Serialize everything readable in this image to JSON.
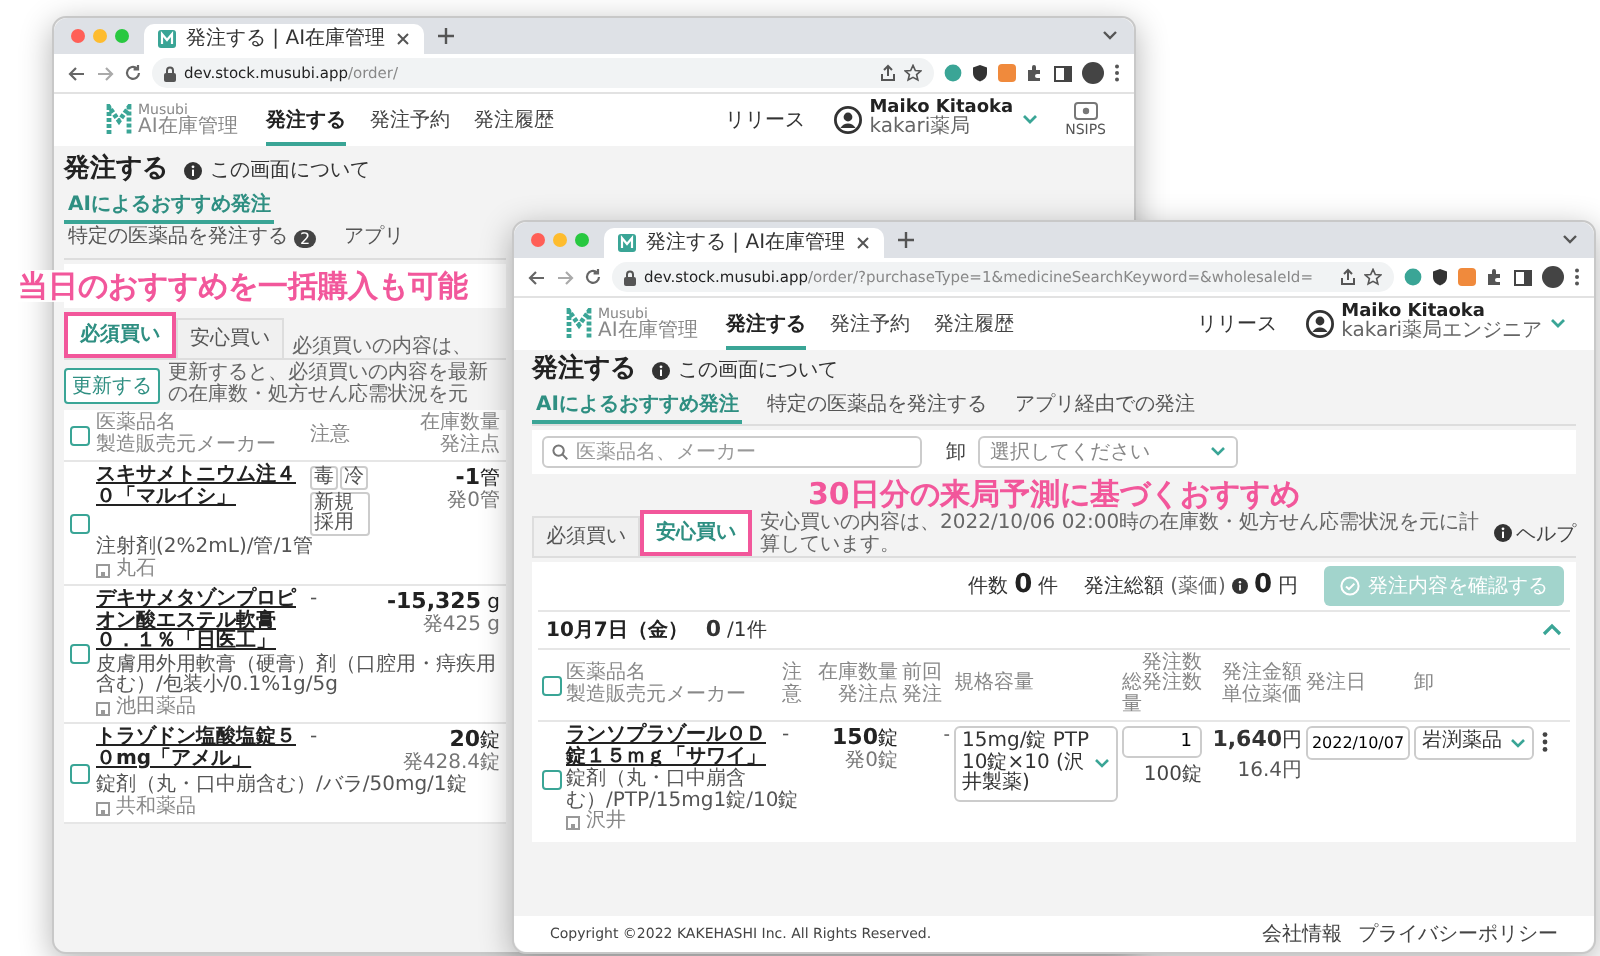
{
  "windows": [
    {
      "kind": "back",
      "browser_tab": "発注する | AI在庫管理",
      "url": "**dev.stock.musubi.app**/order/",
      "logo": {
        "name": "Musubi",
        "subtitle": "AI在庫管理"
      },
      "nav": [
        {
          "label": "発注する",
          "selected": true
        },
        {
          "label": "発注予約",
          "selected": false
        },
        {
          "label": "発注履歴",
          "selected": false
        }
      ],
      "release_link": "リリース",
      "user": {
        "name": "Maiko Kitaoka",
        "org": "kakari薬局"
      },
      "nsips": "NSIPS",
      "page_title": "発注する",
      "about_link": "この画面について",
      "tabs": [
        {
          "label": "AIによるおすすめ発注",
          "selected": true
        },
        {
          "label": "特定の医薬品を発注する",
          "selected": false,
          "badge": "2"
        },
        {
          "label": "アプリ",
          "selected": false
        }
      ],
      "annotation": "当日のおすすめを一括購入も可能",
      "subtabs": [
        {
          "label": "必須買い",
          "selected": true,
          "highlighted": true
        },
        {
          "label": "安心買い",
          "selected": false,
          "highlighted": false
        }
      ],
      "subtab_note": "必須買いの内容は、",
      "update_button": "更新する",
      "update_note": "更新すると、必須買いの内容を最新の在庫数・処方せん応需状況を元",
      "table": {
        "select_all_checked": false,
        "columns": [
          [
            "医薬品名",
            "製造販売元メーカー"
          ],
          [
            "注意"
          ],
          [
            "在庫数量",
            "発注点"
          ]
        ],
        "rows": [
          {
            "checked": false,
            "name": "スキサメトニウム注４０「マルイシ」",
            "spec": "注射剤(2%2mL)/管/1管",
            "maker": "丸石",
            "caution_tags": [
              "毒",
              "冷",
              "新規採用"
            ],
            "stock": "**-1**管",
            "order_point": "発0管"
          },
          {
            "checked": false,
            "name": "デキサメタゾンプロピオン酸エステル軟膏０．１％「日医工」",
            "spec": "皮膚用外用軟膏（硬膏）剤（口腔用・痔疾用含む）/包装小/0.1%1g/5g",
            "maker": "池田薬品",
            "caution": "-",
            "stock": "**-15,325** g",
            "order_point": "発425 g"
          },
          {
            "checked": false,
            "name": "トラゾドン塩酸塩錠５０mg「アメル」",
            "spec": "錠剤（丸・口中崩含む）/バラ/50mg/1錠",
            "maker": "共和薬品",
            "caution": "-",
            "stock": "**20**錠",
            "order_point": "発428.4錠"
          }
        ]
      }
    },
    {
      "kind": "front",
      "browser_tab": "発注する | AI在庫管理",
      "url": "**dev.stock.musubi.app**/order/?purchaseType=1&medicineSearchKeyword=&wholesaleId=",
      "logo": {
        "name": "Musubi",
        "subtitle": "AI在庫管理"
      },
      "nav": [
        {
          "label": "発注する",
          "selected": true
        },
        {
          "label": "発注予約",
          "selected": false
        },
        {
          "label": "発注履歴",
          "selected": false
        }
      ],
      "release_link": "リリース",
      "user": {
        "name": "Maiko Kitaoka",
        "org": "kakari薬局エンジニア"
      },
      "page_title": "発注する",
      "about_link": "この画面について",
      "tabs": [
        {
          "label": "AIによるおすすめ発注",
          "selected": true
        },
        {
          "label": "特定の医薬品を発注する",
          "selected": false
        },
        {
          "label": "アプリ経由での発注",
          "selected": false
        }
      ],
      "search": {
        "placeholder": "医薬品名、メーカー"
      },
      "wholesaler_label": "卸",
      "wholesaler_select": {
        "placeholder": "選択してください"
      },
      "annotation": "30日分の来局予測に基づくおすすめ",
      "subtabs": [
        {
          "label": "必須買い",
          "selected": false,
          "highlighted": false
        },
        {
          "label": "安心買い",
          "selected": true,
          "highlighted": true
        }
      ],
      "subtab_note": "安心買いの内容は、2022/10/06 02:00時の在庫数・処方せん応需状況を元に計算しています。",
      "help": "ヘルプ",
      "summary": {
        "count_label": "件数",
        "count": "0",
        "count_unit": "件",
        "total_label": "発注総額",
        "total_note": "(薬価)",
        "total": "0",
        "total_unit": "円",
        "confirm_button": {
          "label": "発注内容を確認する",
          "disabled": true
        }
      },
      "group": {
        "date": "10月7日（金）",
        "count": "0",
        "count_total": "/1件",
        "expanded": true
      },
      "table": {
        "select_all_checked": false,
        "columns": [
          [
            "医薬品名",
            "製造販売元メーカー"
          ],
          [
            "注意"
          ],
          [
            "在庫数量",
            "発注点"
          ],
          [
            "前回発注"
          ],
          [
            "規格容量"
          ],
          [
            "発注数",
            "総発注数量"
          ],
          [
            "発注金額",
            "単位薬価"
          ],
          [
            "発注日"
          ],
          [
            "卸"
          ]
        ],
        "rows": [
          {
            "checked": false,
            "name": "ランソプラゾールＯＤ錠１５ｍｇ「サワイ」",
            "spec": "錠剤（丸・口中崩含む）/PTP/15mg1錠/10錠",
            "maker": "沢井",
            "caution": "-",
            "stock": "**150**錠",
            "order_point": "発0錠",
            "last_order": "-",
            "package": "15mg/錠 PTP 10錠×10 (沢井製薬)",
            "quantity": "1",
            "total_quantity": "100錠",
            "amount": "**1,640**円",
            "unit_price": "16.4円",
            "order_date": "2022/10/07",
            "wholesaler": "岩渕薬品"
          }
        ]
      },
      "footer": {
        "copyright": "Copyright ©2022 KAKEHASHI Inc. All Rights Reserved.",
        "links": [
          "会社情報",
          "プライバシーポリシー"
        ]
      }
    }
  ]
}
